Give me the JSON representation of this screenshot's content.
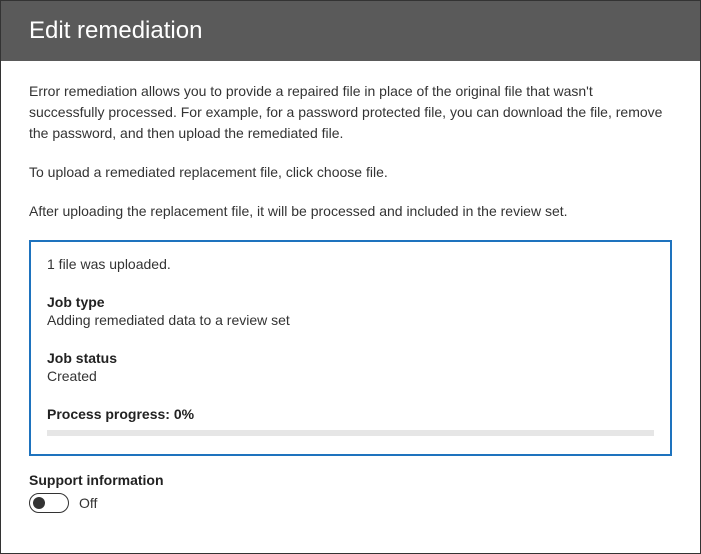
{
  "header": {
    "title": "Edit remediation"
  },
  "description": {
    "para1": "Error remediation allows you to provide a repaired file in place of the original file that wasn't successfully processed. For example, for a password protected file, you can download the file, remove the password, and then upload the remediated file.",
    "para2": "To upload a remediated replacement file, click choose file.",
    "para3": "After uploading the replacement file, it will be processed and included in the review set."
  },
  "status": {
    "upload_message": "1 file was uploaded.",
    "job_type_label": "Job type",
    "job_type_value": "Adding remediated data to a review set",
    "job_status_label": "Job status",
    "job_status_value": "Created",
    "progress_label": "Process progress: 0%",
    "progress_percent": 0
  },
  "support": {
    "title": "Support information",
    "toggle_state": "Off"
  }
}
